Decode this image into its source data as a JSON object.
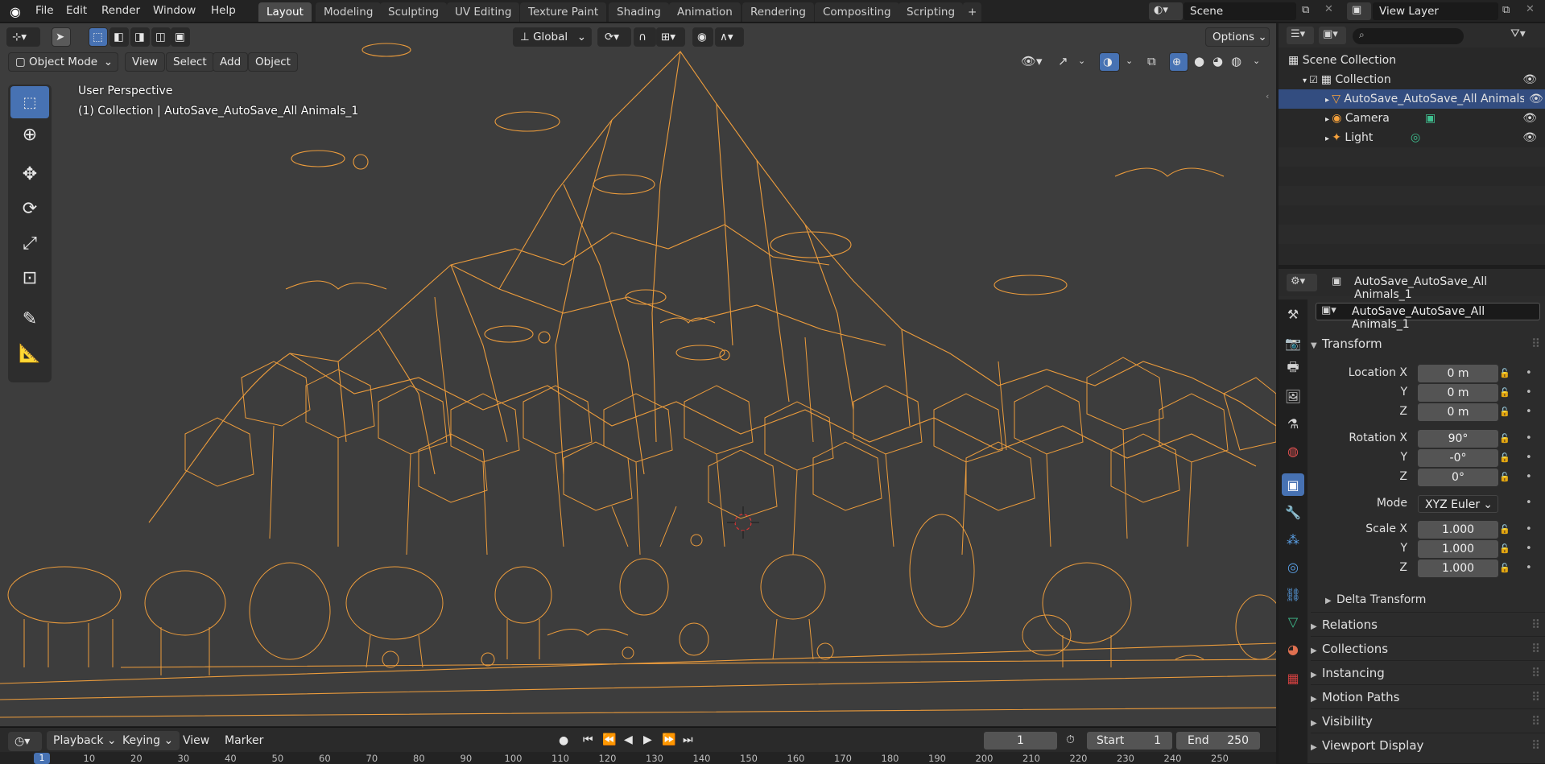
{
  "topbar": {
    "menus": [
      "File",
      "Edit",
      "Render",
      "Window",
      "Help"
    ],
    "workspaces": [
      "Layout",
      "Modeling",
      "Sculpting",
      "UV Editing",
      "Texture Paint",
      "Shading",
      "Animation",
      "Rendering",
      "Compositing",
      "Scripting"
    ],
    "active_workspace": "Layout",
    "add_tab": "+",
    "scene": "Scene",
    "view_layer": "View Layer"
  },
  "viewport": {
    "transform_orientation": "Global",
    "options_label": "Options",
    "mode": "Object Mode",
    "header_menus": [
      "View",
      "Select",
      "Add",
      "Object"
    ],
    "perspective_label": "User Perspective",
    "collection_label": "(1) Collection | AutoSave_AutoSave_All Animals_1",
    "tools": [
      "select-box-icon",
      "cursor-icon",
      "move-icon",
      "rotate-icon",
      "scale-icon",
      "transform-icon",
      "annotate-icon",
      "measure-icon"
    ],
    "wire_color": "#f5a13c",
    "bg_color": "#3d3d3d"
  },
  "timeline": {
    "playback": "Playback",
    "keying": "Keying",
    "view": "View",
    "marker": "Marker",
    "current_frame": "1",
    "start_label": "Start",
    "start_value": "1",
    "end_label": "End",
    "end_value": "250",
    "ruler": [
      "1",
      "10",
      "20",
      "30",
      "40",
      "50",
      "60",
      "70",
      "80",
      "90",
      "100",
      "110",
      "120",
      "130",
      "140",
      "150",
      "160",
      "170",
      "180",
      "190",
      "200",
      "210",
      "220",
      "230",
      "240",
      "250"
    ]
  },
  "outliner": {
    "search_placeholder": "",
    "root": "Scene Collection",
    "items": [
      {
        "label": "Collection"
      },
      {
        "label": "AutoSave_AutoSave_All Animals_1"
      },
      {
        "label": "Camera"
      },
      {
        "label": "Light"
      }
    ]
  },
  "properties": {
    "header_object": "AutoSave_AutoSave_All Animals_1",
    "object_name": "AutoSave_AutoSave_All Animals_1",
    "transform_title": "Transform",
    "location": {
      "label": "Location X",
      "x": "0 m",
      "y": "0 m",
      "z": "0 m"
    },
    "rotation": {
      "label": "Rotation X",
      "x": "90°",
      "y": "-0°",
      "z": "0°"
    },
    "mode_label": "Mode",
    "mode_value": "XYZ Euler",
    "scale": {
      "label": "Scale X",
      "x": "1.000",
      "y": "1.000",
      "z": "1.000"
    },
    "axis_y": "Y",
    "axis_z": "Z",
    "delta_transform": "Delta Transform",
    "panels": [
      "Relations",
      "Collections",
      "Instancing",
      "Motion Paths",
      "Visibility",
      "Viewport Display"
    ]
  }
}
